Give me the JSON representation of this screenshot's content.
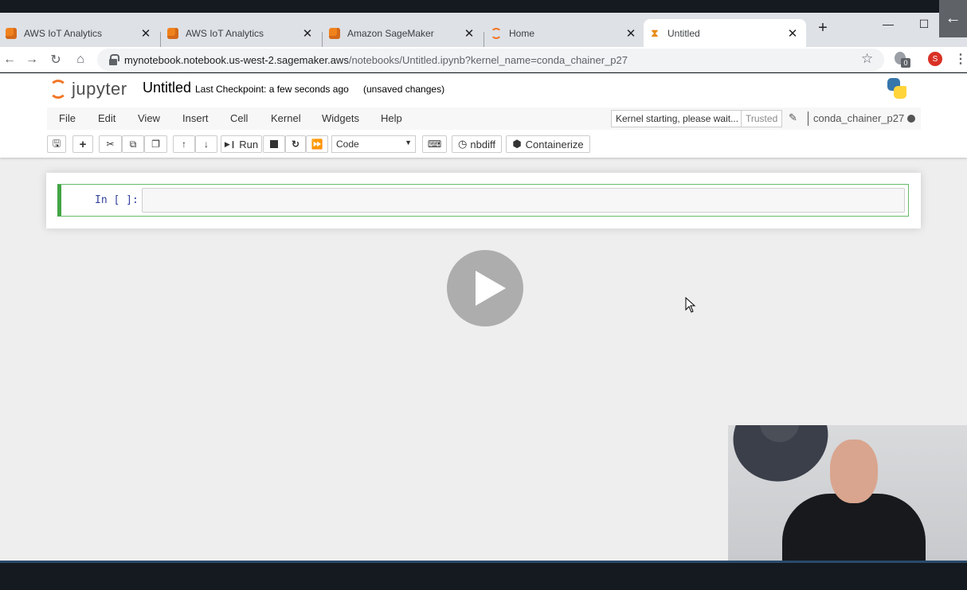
{
  "browser": {
    "tabs": [
      {
        "title": "AWS IoT Analytics",
        "favicon": "aws-cube-icon"
      },
      {
        "title": "AWS IoT Analytics",
        "favicon": "aws-cube-icon"
      },
      {
        "title": "Amazon SageMaker",
        "favicon": "aws-cube-icon"
      },
      {
        "title": "Home",
        "favicon": "jupyter-icon"
      },
      {
        "title": "Untitled",
        "favicon": "hourglass-icon",
        "active": true
      }
    ],
    "url_host": "mynotebook.notebook.us-west-2.sagemaker.aws",
    "url_path": "/notebooks/Untitled.ipynb?kernel_name=conda_chainer_p27",
    "extension_badge": "0",
    "profile_initial": "S"
  },
  "jupyter": {
    "logo_text": "jupyter",
    "notebook_title": "Untitled",
    "checkpoint": "Last Checkpoint: a few seconds ago",
    "unsaved": "(unsaved changes)",
    "menu": [
      "File",
      "Edit",
      "View",
      "Insert",
      "Cell",
      "Kernel",
      "Widgets",
      "Help"
    ],
    "kernel_status": "Kernel starting, please wait...",
    "trusted": "Trusted",
    "kernel_name": "conda_chainer_p27",
    "toolbar": {
      "run": "Run",
      "cell_type": "Code",
      "nbdiff": "nbdiff",
      "containerize": "Containerize"
    },
    "cell_prompt": "In [ ]:"
  },
  "colors": {
    "jupyter_orange": "#f37626",
    "cell_selected_green": "#42a546",
    "prompt_blue": "#303f9f"
  }
}
